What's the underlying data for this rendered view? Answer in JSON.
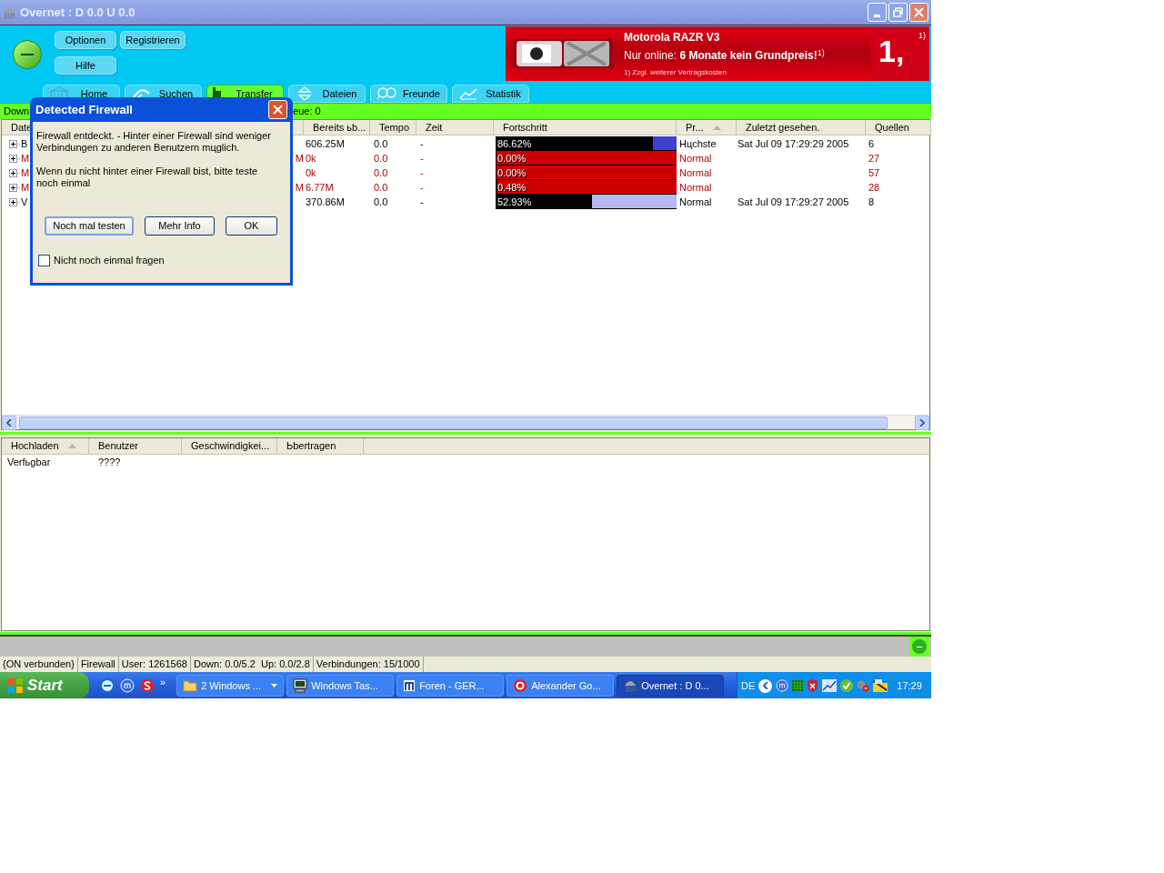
{
  "window": {
    "title": "Overnet : D 0.0 U 0.0"
  },
  "toolbar": {
    "buttons": [
      {
        "label": "Optionen"
      },
      {
        "label": "Registrieren"
      },
      {
        "label": "Hilfe"
      }
    ]
  },
  "ad": {
    "headline": "Motorola RAZR V3",
    "offer": "Nur online: **6 Monate kein Grundpreis!**$^{1)}$",
    "footnote": "1) Zzgl. weiterer Vertragskosten",
    "logo": "1,",
    "logo_note": "1)"
  },
  "tabs": [
    {
      "label": "Home",
      "kind": "home",
      "selected": false
    },
    {
      "label": "Suchen",
      "kind": "search",
      "selected": false
    },
    {
      "label": "Transfer",
      "kind": "transfer",
      "selected": true
    },
    {
      "label": "Dateien",
      "kind": "files",
      "selected": false
    },
    {
      "label": "Freunde",
      "kind": "friends",
      "selected": false
    },
    {
      "label": "Statistik",
      "kind": "stats",
      "selected": false
    }
  ],
  "info_bar": {
    "left": "Down",
    "right": "eue: 0"
  },
  "downloads": {
    "columns": [
      {
        "label": "Date"
      },
      {
        "label": "Bereits ьb..."
      },
      {
        "label": "Tempo"
      },
      {
        "label": "Zeit"
      },
      {
        "label": "Fortschritt"
      },
      {
        "label": "Pr...",
        "sorted": true
      },
      {
        "label": "Zuletzt gesehen."
      },
      {
        "label": "Quellen"
      }
    ],
    "rows": [
      {
        "name": "B",
        "done": "606.25M",
        "speed": "0.0",
        "time": "-",
        "progress": "86.62%",
        "level": 0.8662,
        "color": "#4040d0",
        "stalled": false,
        "priority": "Hцchste",
        "last_seen": "Sat Jul 09 17:29:29 2005",
        "sources": "6"
      },
      {
        "name": "M",
        "tail": "M",
        "done": "0k",
        "speed": "0.0",
        "time": "-",
        "progress": "0.00%",
        "level": 0,
        "color": "#cc0000",
        "stalled": true,
        "priority": "Normal",
        "sources": "27"
      },
      {
        "name": "M",
        "done": "0k",
        "speed": "0.0",
        "time": "-",
        "progress": "0.00%",
        "level": 0,
        "color": "#cc0000",
        "stalled": true,
        "priority": "Normal",
        "sources": "57"
      },
      {
        "name": "M",
        "tail": "M",
        "done": "6.77M",
        "speed": "0.0",
        "time": "-",
        "progress": "0.48%",
        "level": 0.0048,
        "color": "#cc0000",
        "stalled": true,
        "priority": "Normal",
        "sources": "28"
      },
      {
        "name": "V",
        "done": "370.86M",
        "speed": "0.0",
        "time": "-",
        "progress": "52.93%",
        "level": 0.5293,
        "color": "#b8b8f0",
        "stalled": false,
        "priority": "Normal",
        "last_seen": "Sat Jul 09 17:29:27 2005",
        "sources": "8"
      }
    ]
  },
  "uploads": {
    "columns": [
      {
        "label": "Hochladen",
        "sorted": true
      },
      {
        "label": "Benutzer"
      },
      {
        "label": "Geschwindigkei..."
      },
      {
        "label": "Ьbertragen"
      }
    ],
    "rows": [
      {
        "cells": [
          "Verfьgbar",
          "????"
        ]
      }
    ]
  },
  "status_bar": {
    "segments": [
      "{ON verbunden}",
      "Firewall",
      "User: 1261568",
      "Down: 0.0/5.2  Up: 0.0/2.8",
      "Verbindungen: 15/1000"
    ]
  },
  "dialog": {
    "title": "Detected Firewall",
    "paragraphs": [
      "Firewall entdeckt. - Hinter einer Firewall sind weniger\nVerbindungen zu anderen Benutzern mцglich.",
      "Wenn du nicht hinter einer Firewall bist, bitte teste\nnoch einmal"
    ],
    "buttons": [
      {
        "label": "Noch mal testen",
        "default": true
      },
      {
        "label": "Mehr Info",
        "default": false
      },
      {
        "label": "OK",
        "default": false
      }
    ],
    "checkbox": {
      "label": "Nicht noch einmal fragen",
      "checked": false
    }
  },
  "taskbar": {
    "start": "Start",
    "quick_launch_more": "»",
    "tasks": [
      {
        "label": "2 Windows ...",
        "kind": "folder",
        "grouped": true,
        "selected": false
      },
      {
        "label": "Windows Tas...",
        "kind": "monitor",
        "grouped": false,
        "selected": false
      },
      {
        "label": "Foren - GER...",
        "kind": "web",
        "grouped": false,
        "selected": false
      },
      {
        "label": "Alexander Go...",
        "kind": "chat",
        "grouped": false,
        "selected": false
      },
      {
        "label": "Overnet : D 0...",
        "kind": "app",
        "grouped": false,
        "selected": true
      }
    ],
    "language": "DE",
    "clock": "17:29"
  }
}
